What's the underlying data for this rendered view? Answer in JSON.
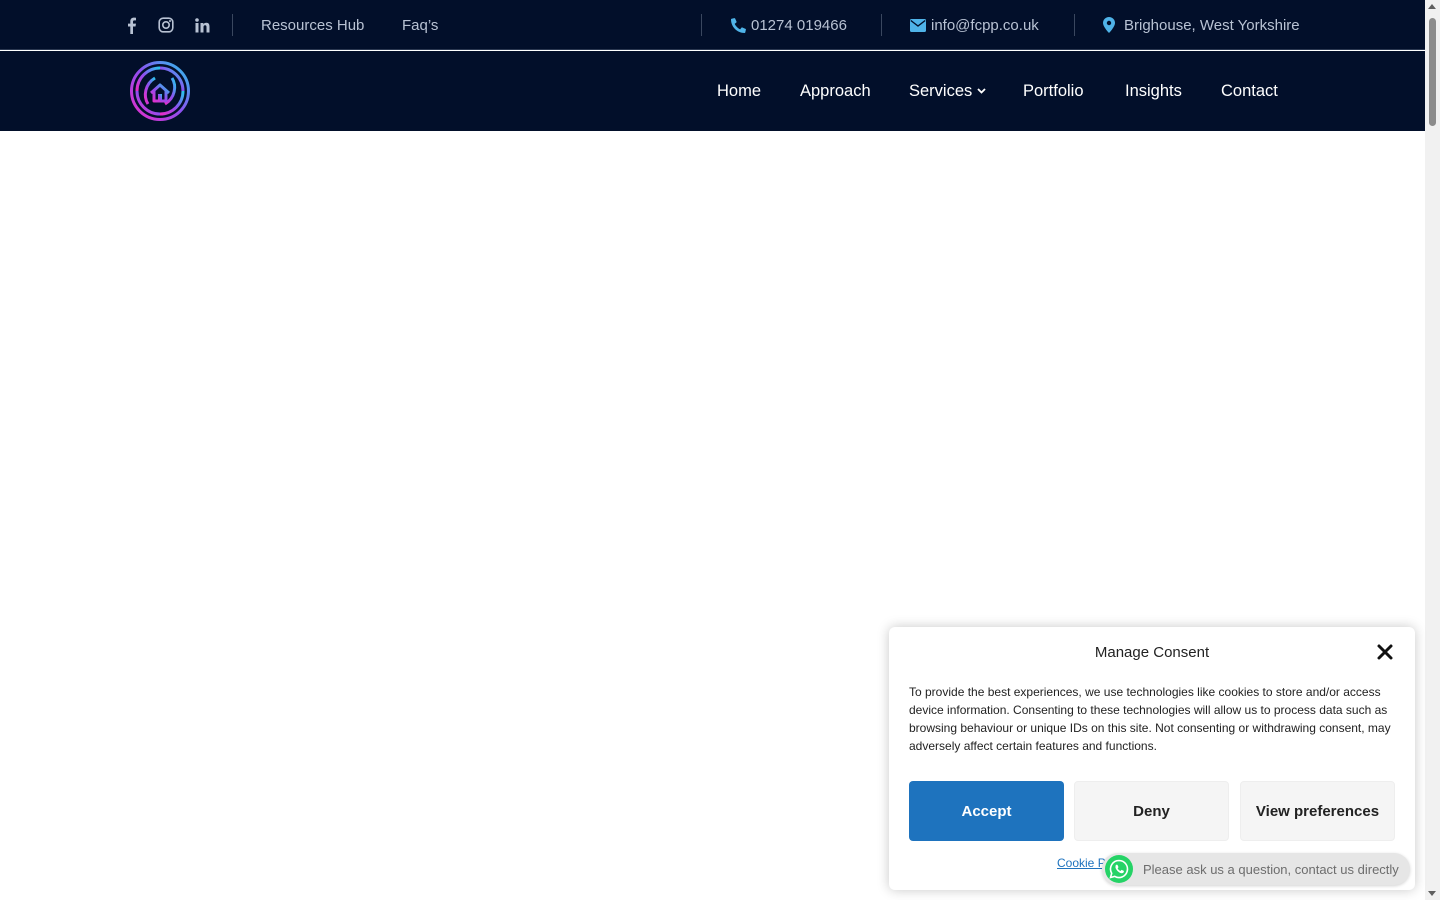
{
  "topbar": {
    "social": [
      "facebook-icon",
      "instagram-icon",
      "linkedin-icon"
    ],
    "links": [
      "Resources Hub",
      "Faq’s"
    ],
    "phone": "01274 019466",
    "email": "info@fcpp.co.uk",
    "location": "Brighouse, West Yorkshire"
  },
  "nav": {
    "items": [
      "Home",
      "Approach",
      "Services",
      "Portfolio",
      "Insights",
      "Contact"
    ]
  },
  "consent": {
    "title": "Manage Consent",
    "message": "To provide the best experiences, we use technologies like cookies to store and/or access device information. Consenting to these technologies will allow us to process data such as browsing behaviour or unique IDs on this site. Not consenting or withdrawing consent, may adversely affect certain features and functions.",
    "accept": "Accept",
    "deny": "Deny",
    "preferences": "View preferences",
    "policy": "Cookie P"
  },
  "whatsapp": {
    "text": "Please ask us a question, contact us directly"
  },
  "colors": {
    "header_bg": "#020f2a",
    "accent_blue": "#1e73be",
    "icon_blue": "#4fb3e8"
  }
}
